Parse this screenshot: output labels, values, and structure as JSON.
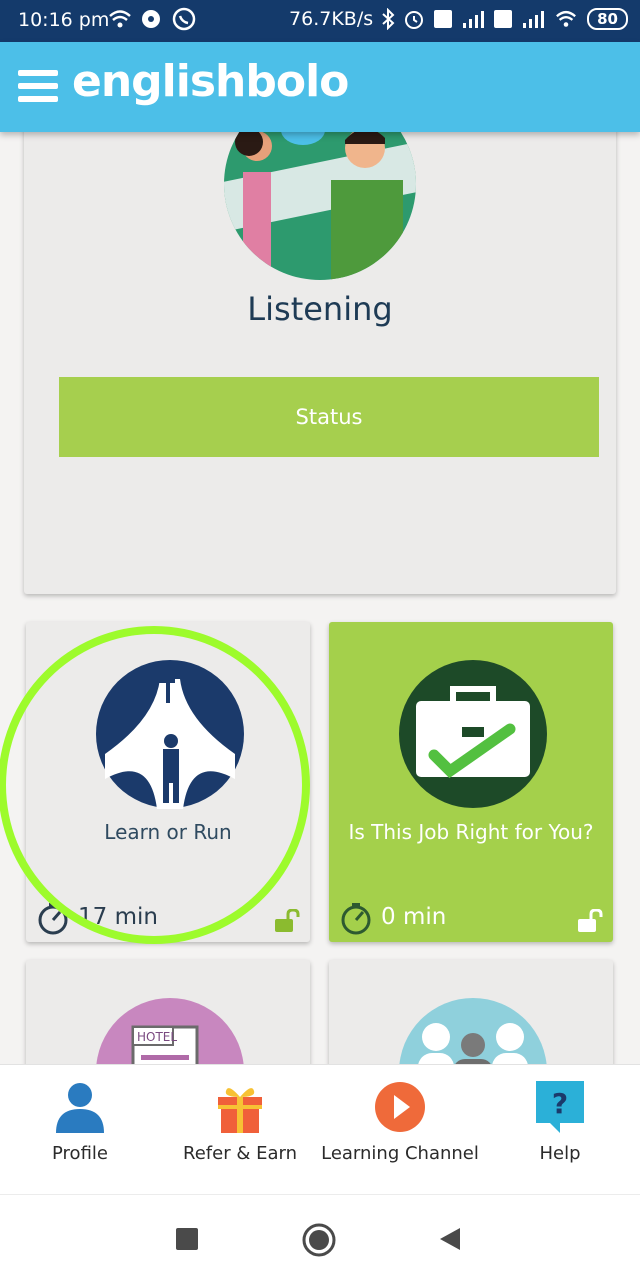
{
  "status_bar": {
    "time": "10:16 pm",
    "speed": "76.7KB/s",
    "battery": "80",
    "icons": [
      "wifi-icon",
      "mute-icon",
      "whatsapp-icon",
      "bluetooth-icon",
      "alarm-icon",
      "volte-icon",
      "signal-icon",
      "wifi-icon",
      "battery-icon"
    ]
  },
  "app_bar": {
    "brand": "englishbolo",
    "menu_icon": "hamburger-menu-icon",
    "color": "#4cbfe8"
  },
  "listening_card": {
    "title": "Listening",
    "button_label": "Status",
    "button_color": "#a6cf4e"
  },
  "tiles": [
    {
      "title": "Learn or Run",
      "duration": "17 min",
      "icon": "crossroads-icon",
      "background": "#ecebea",
      "lock_icon": "unlock-icon"
    },
    {
      "title": "Is This Job Right for You?",
      "duration": "0 min",
      "icon": "briefcase-check-icon",
      "background": "#a4d04b",
      "lock_icon": "unlock-icon"
    },
    {
      "icon": "hotel-document-icon"
    },
    {
      "icon": "group-people-icon"
    }
  ],
  "bottom_nav": {
    "items": [
      {
        "label": "Profile",
        "icon": "profile-icon"
      },
      {
        "label": "Refer & Earn",
        "icon": "gift-icon"
      },
      {
        "label": "Learning Channel",
        "icon": "play-icon"
      },
      {
        "label": "Help",
        "icon": "help-icon"
      }
    ]
  },
  "system_nav": {
    "icons": [
      "recents-icon",
      "home-icon",
      "back-icon"
    ]
  },
  "colors": {
    "status_bar": "#143a6b",
    "accent_green": "#a4d04b",
    "highlight_ring": "#9dfb2c",
    "dark_navy": "#1b3a6b"
  }
}
